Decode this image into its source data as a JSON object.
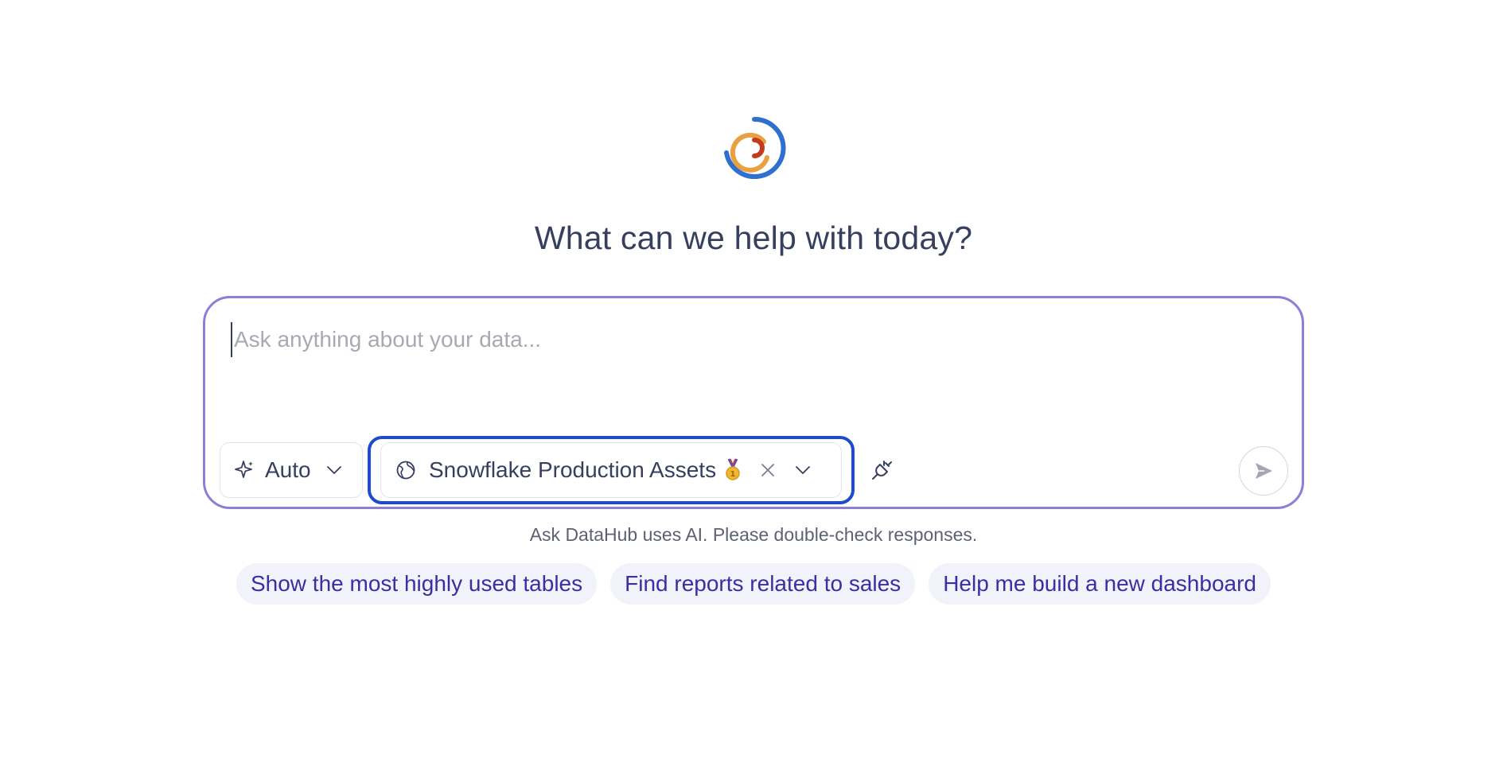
{
  "headline": "What can we help with today?",
  "composer": {
    "placeholder": "Ask anything about your data...",
    "model_selector": {
      "label": "Auto",
      "icon": "sparkle-icon"
    },
    "scope_selector": {
      "label": "Snowflake Production Assets",
      "icon": "globe-icon",
      "badge_icon": "medal-icon"
    },
    "send_icon": "send-icon",
    "connector_icon": "plug-icon"
  },
  "disclaimer": "Ask DataHub uses AI. Please double-check responses.",
  "suggestions": [
    "Show the most highly used tables",
    "Find reports related to sales",
    "Help me build a new dashboard"
  ],
  "colors": {
    "composer_border": "#8c7fd6",
    "scope_focus_border": "#1d4bc9",
    "headline": "#373f5f",
    "chip_bg": "#f2f2fb",
    "chip_text": "#3b2ea3",
    "logo_blue": "#2f6fd0",
    "logo_orange": "#e8a040",
    "logo_red": "#c43b1c"
  }
}
